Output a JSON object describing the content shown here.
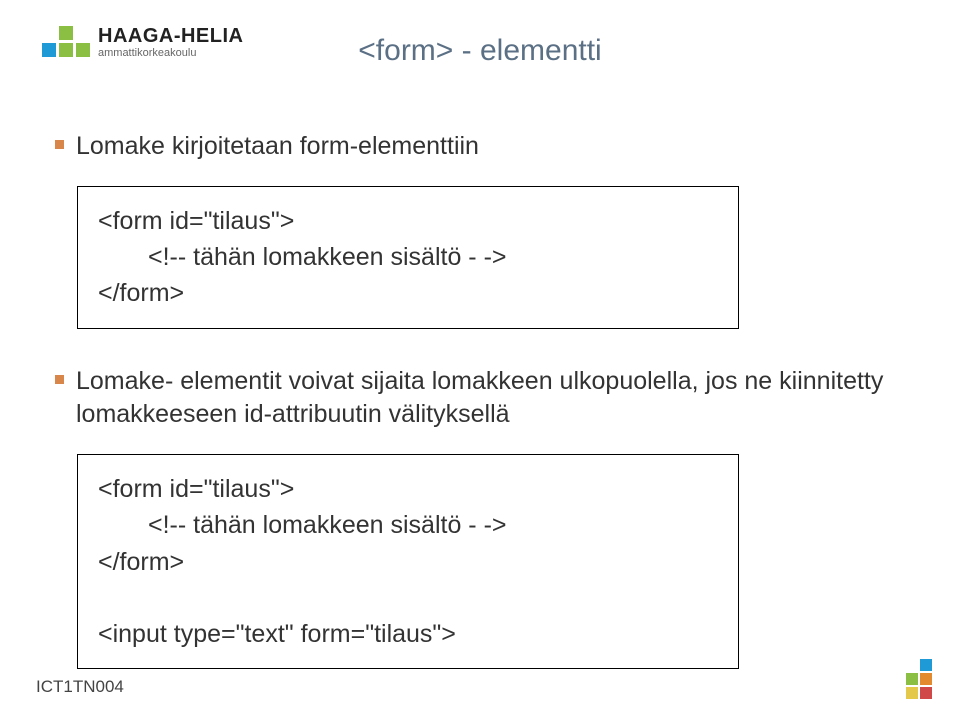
{
  "logo": {
    "main": "HAAGA-HELIA",
    "sub": "ammattikorkeakoulu"
  },
  "title": "<form> - elementti",
  "bullets": {
    "b1": "Lomake kirjoitetaan form-elementtiin",
    "b2": "Lomake- elementit voivat sijaita lomakkeen ulkopuolella, jos ne kiinnitetty lomakkeeseen id-attribuutin välityksellä"
  },
  "code1": {
    "line1": "<form id=\"tilaus\">",
    "line2": "<!-- tähän lomakkeen sisältö  - ->",
    "line3": "</form>"
  },
  "code2": {
    "line1": "<form id=\"tilaus\">",
    "line2": "<!-- tähän lomakkeen sisältö  - ->",
    "line3": "</form>",
    "line4": "",
    "line5": "<input type=\"text\" form=\"tilaus\">"
  },
  "footer": "ICT1TN004"
}
